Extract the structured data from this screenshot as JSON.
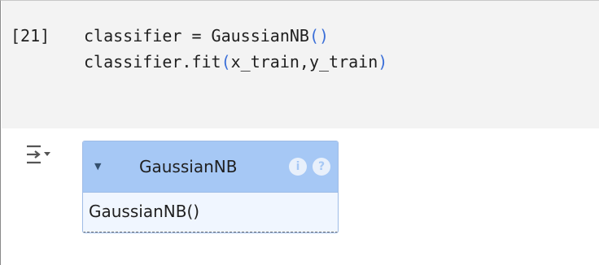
{
  "cell": {
    "execution_count": "[21]",
    "code_lines": [
      {
        "text": "classifier = GaussianNB",
        "paren": "()"
      },
      {
        "text": "classifier.fit",
        "paren_open": "(",
        "args": "x_train,y_train",
        "paren_close": ")"
      }
    ]
  },
  "output": {
    "toggle_icon": "output-collapse-icon",
    "estimator": {
      "toggle_glyph": "▼",
      "name": "GaussianNB",
      "info_icon_glyph": "i",
      "help_icon_glyph": "?",
      "repr": "GaussianNB()"
    }
  },
  "colors": {
    "code_background": "#f3f3f3",
    "paren_color": "#3b6fd8",
    "estimator_header": "#a6c8f5",
    "estimator_body": "#f0f6ff"
  }
}
